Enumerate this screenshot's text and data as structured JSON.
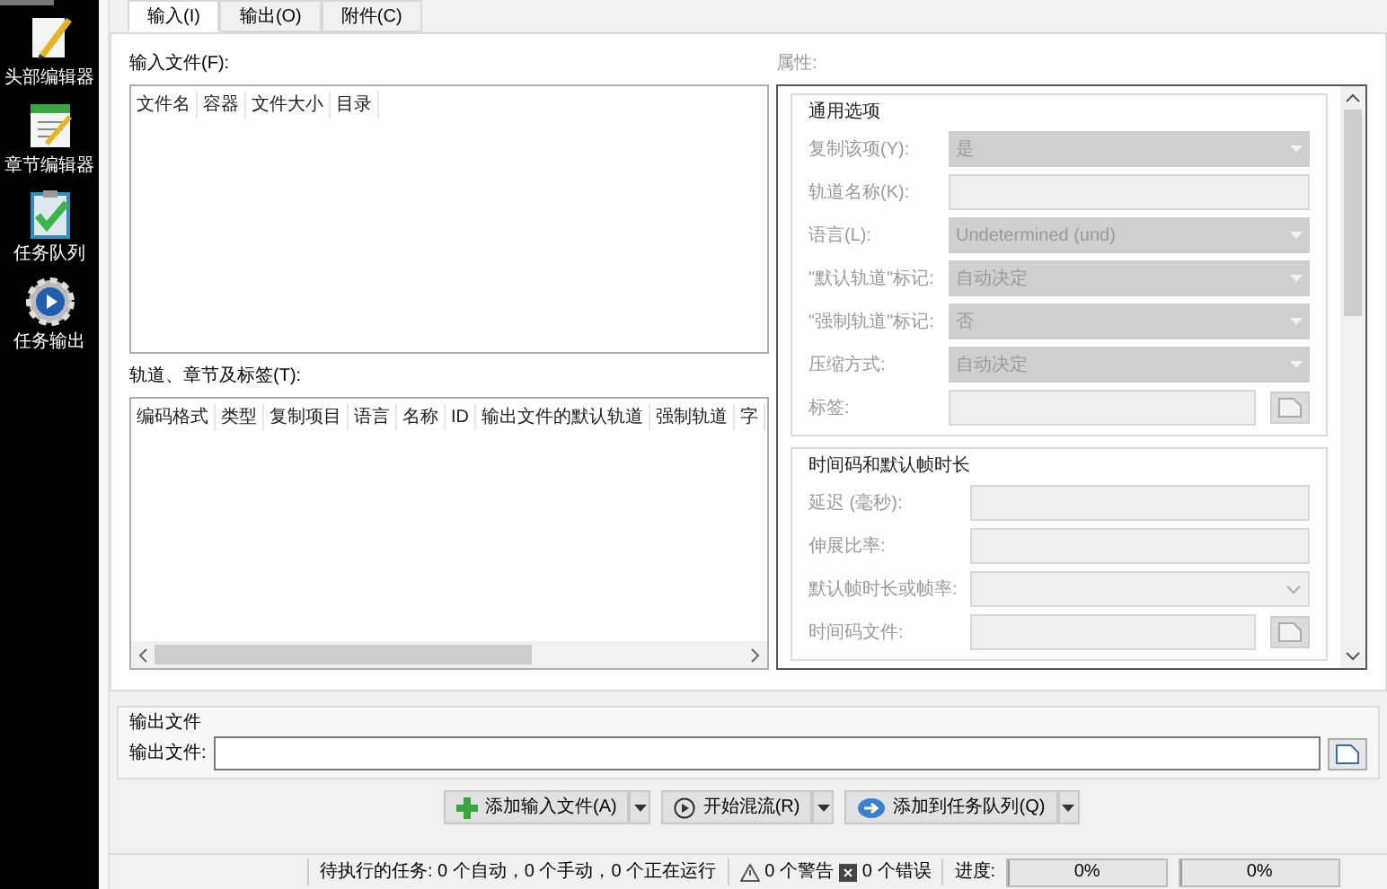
{
  "sidebar": {
    "items": [
      {
        "label": "头部编辑器"
      },
      {
        "label": "章节编辑器"
      },
      {
        "label": "任务队列"
      },
      {
        "label": "任务输出"
      }
    ]
  },
  "tabs": [
    {
      "label": "输入(I)",
      "selected": true
    },
    {
      "label": "输出(O)",
      "selected": false
    },
    {
      "label": "附件(C)",
      "selected": false
    }
  ],
  "input_files": {
    "label": "输入文件(F):",
    "columns": [
      "文件名",
      "容器",
      "文件大小",
      "目录"
    ]
  },
  "tracks": {
    "label": "轨道、章节及标签(T):",
    "columns": [
      "编码格式",
      "类型",
      "复制项目",
      "语言",
      "名称",
      "ID",
      "输出文件的默认轨道",
      "强制轨道",
      "字"
    ]
  },
  "properties": {
    "label": "属性:",
    "groups": [
      {
        "title": "通用选项",
        "fields": [
          {
            "kind": "select",
            "label": "复制该项(Y):",
            "value": "是",
            "disabled": true
          },
          {
            "kind": "input",
            "label": "轨道名称(K):",
            "disabled": true
          },
          {
            "kind": "select",
            "label": "语言(L):",
            "value": "Undetermined (und)",
            "disabled": true
          },
          {
            "kind": "select",
            "label": "\"默认轨道\"标记:",
            "value": "自动决定",
            "disabled": true
          },
          {
            "kind": "select",
            "label": "\"强制轨道\"标记:",
            "value": "否",
            "disabled": true
          },
          {
            "kind": "select",
            "label": "压缩方式:",
            "value": "自动决定",
            "disabled": true
          },
          {
            "kind": "file",
            "label": "标签:",
            "disabled": true
          }
        ]
      },
      {
        "title": "时间码和默认帧时长",
        "fields": [
          {
            "kind": "input",
            "label": "延迟 (毫秒):",
            "disabled": true
          },
          {
            "kind": "input",
            "label": "伸展比率:",
            "disabled": true
          },
          {
            "kind": "combo",
            "label": "默认帧时长或帧率:",
            "disabled": true
          },
          {
            "kind": "file",
            "label": "时间码文件:",
            "disabled": true
          }
        ]
      }
    ]
  },
  "output": {
    "title": "输出文件",
    "label": "输出文件:"
  },
  "buttons": [
    {
      "label": "添加输入文件(A)"
    },
    {
      "label": "开始混流(R)"
    },
    {
      "label": "添加到任务队列(Q)"
    }
  ],
  "status_bar": {
    "tasks": "待执行的任务: 0 个自动，0 个手动，0 个正在运行",
    "warnings": "0 个警告",
    "errors": "0 个错误",
    "progress_label": "进度:",
    "progress": [
      {
        "level": 0,
        "reading": "0%"
      },
      {
        "level": 0,
        "reading": "0%"
      }
    ]
  }
}
